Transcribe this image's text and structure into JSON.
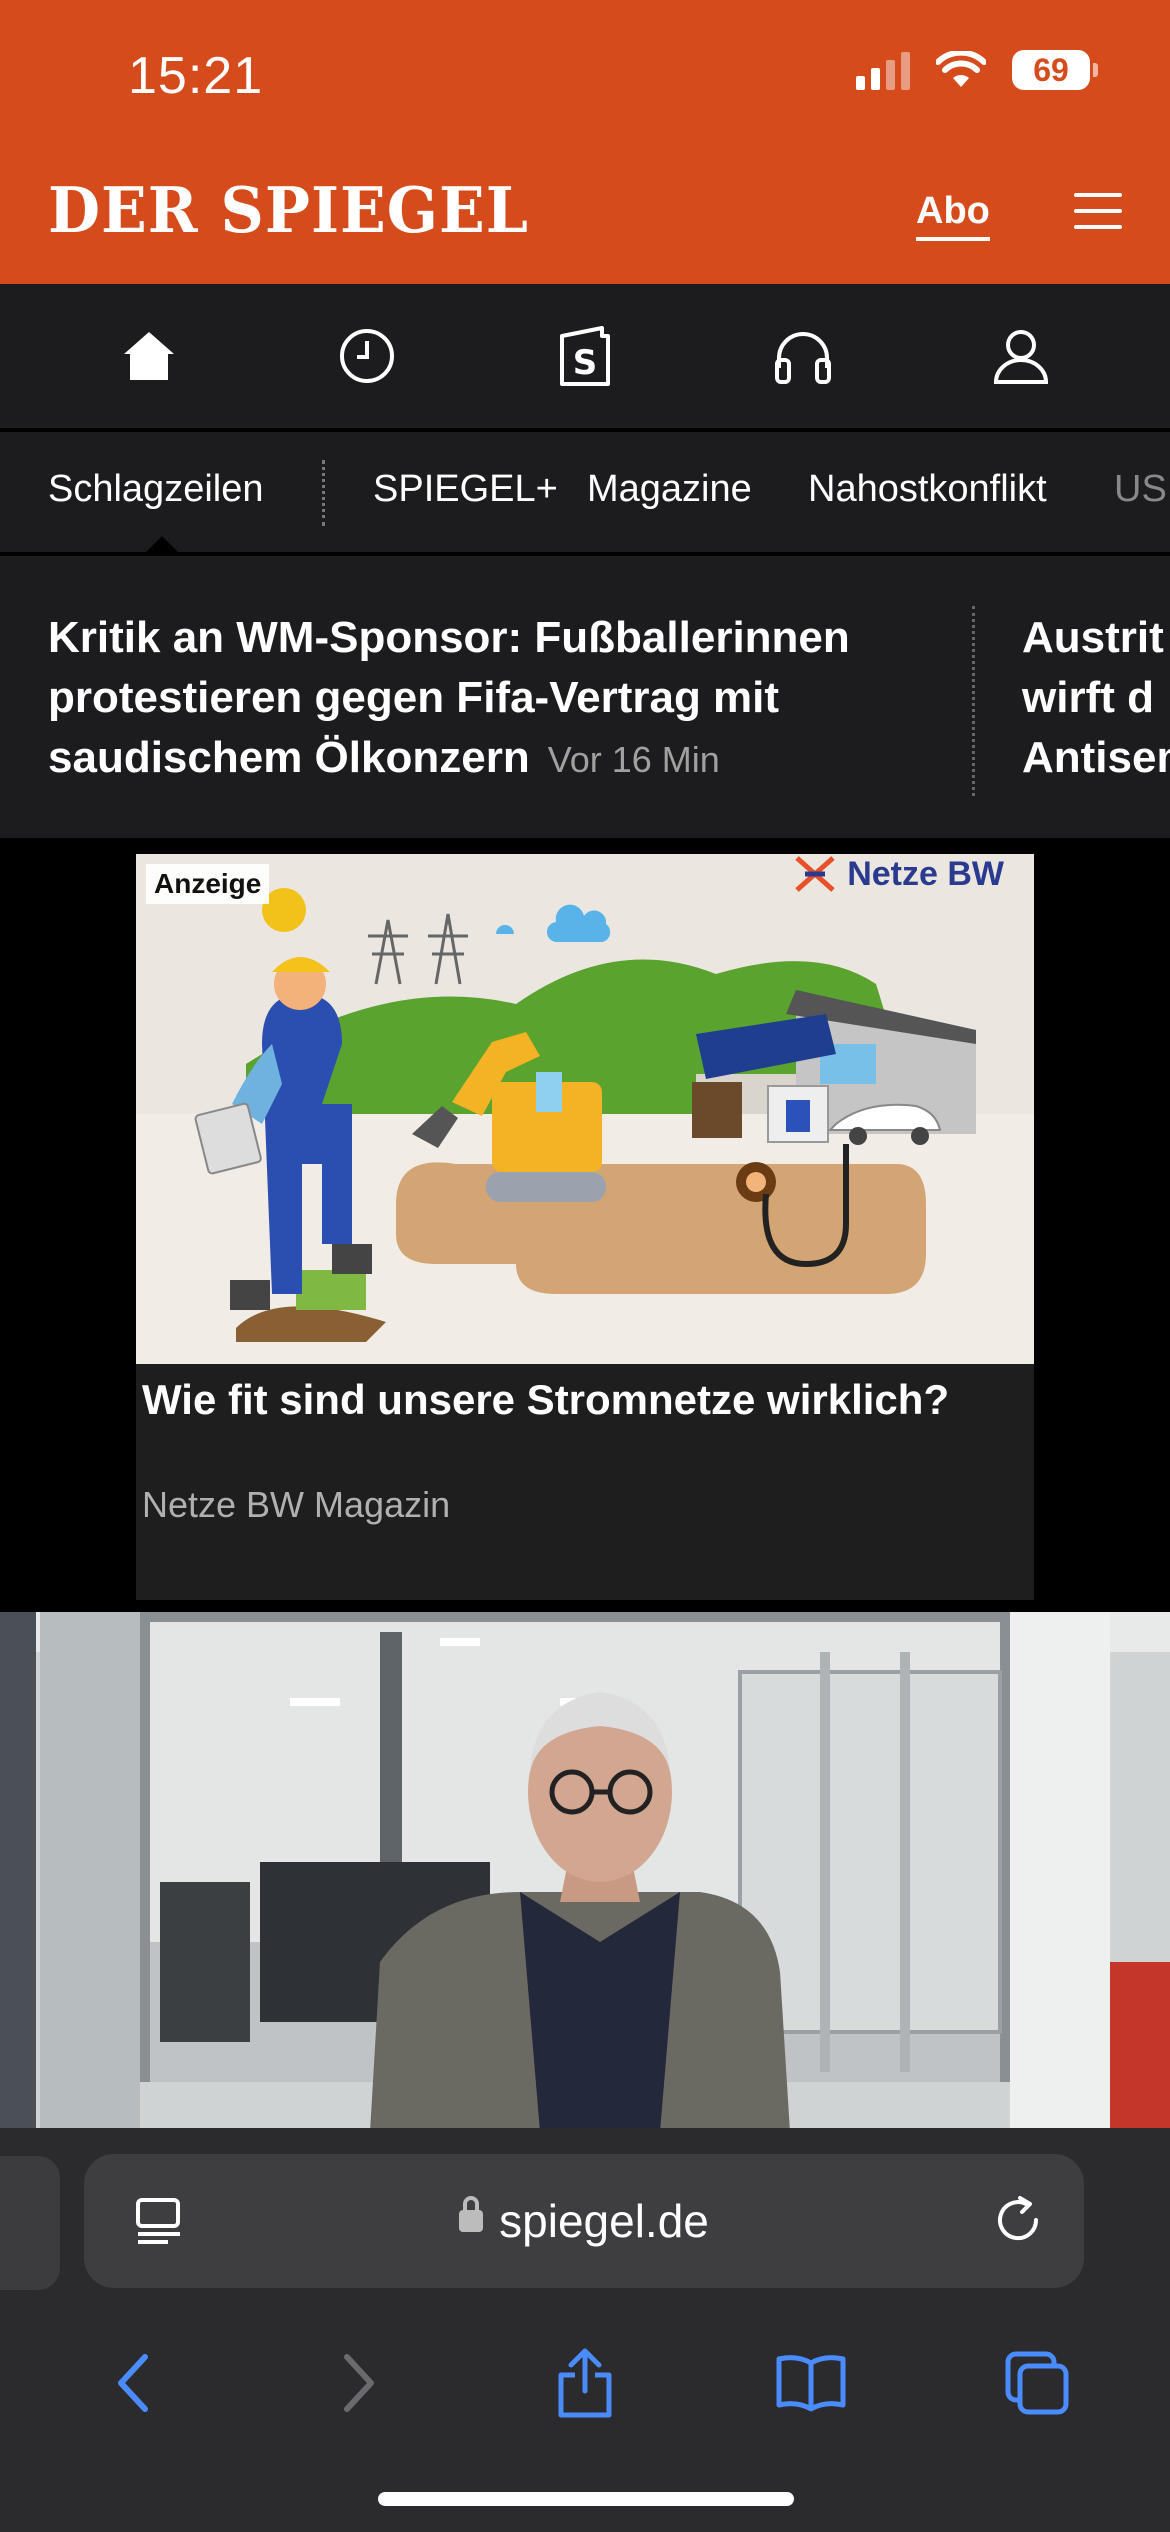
{
  "status_bar": {
    "time": "15:21",
    "battery": "69"
  },
  "header": {
    "logo": "DER SPIEGEL",
    "abo_label": "Abo"
  },
  "icon_nav": [
    "home-icon",
    "history-icon",
    "spiegel-plus-icon",
    "headphones-icon",
    "account-icon"
  ],
  "tabs": [
    "Schlagzeilen",
    "SPIEGEL+",
    "Magazine",
    "Nahostkonflikt",
    "US"
  ],
  "headlines": [
    {
      "title": "Kritik an WM-Sponsor: Fußballerinnen protestieren gegen Fifa-Vertrag mit saudischem Ölkonzern",
      "time": "Vor 16 Min"
    },
    {
      "title_lines": [
        "Austrit",
        "wirft d",
        "Antisem"
      ]
    }
  ],
  "ad": {
    "label": "Anzeige",
    "brand": "Netze BW",
    "title": "Wie fit sind unsere Stromnetze wirklich?",
    "source": "Netze BW Magazin"
  },
  "browser": {
    "url": "spiegel.de"
  },
  "colors": {
    "brand": "#d64b1c",
    "dark": "#1c1c1e",
    "safari_blue": "#4a8cff"
  }
}
